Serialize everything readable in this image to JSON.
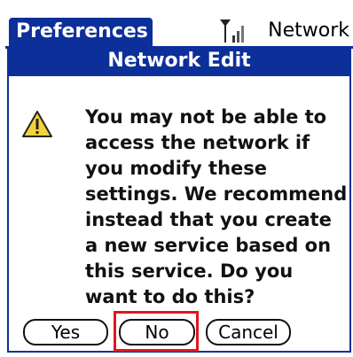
{
  "titlebar": {
    "app_title": "Preferences",
    "category": "Network"
  },
  "icons": {
    "signal": "signal-strength-icon",
    "warning": "warning-icon"
  },
  "dialog": {
    "title": "Network Edit",
    "message": "You may not be able to access the network if you modify these settings. We recommend instead that you create a new service based on this service. Do you want to do this?",
    "buttons": {
      "yes": "Yes",
      "no": "No",
      "cancel": "Cancel"
    }
  },
  "colors": {
    "accent": "#0d2f9a",
    "highlight": "#e3141f"
  }
}
